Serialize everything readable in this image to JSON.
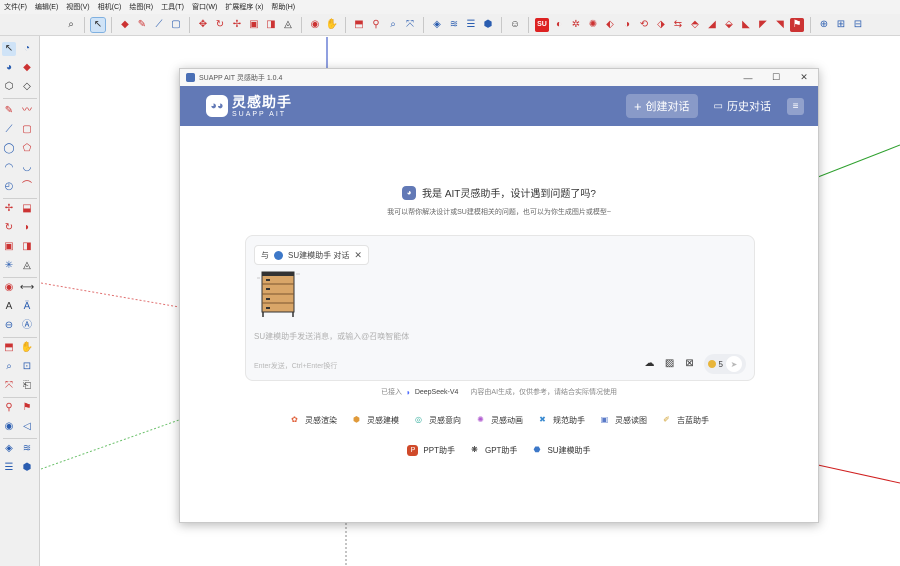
{
  "menu": [
    "文件(F)",
    "编辑(E)",
    "视图(V)",
    "相机(C)",
    "绘图(R)",
    "工具(T)",
    "窗口(W)",
    "扩展程序 (x)",
    "帮助(H)"
  ],
  "window": {
    "title": "SUAPP AIT 灵感助手 1.0.4",
    "minimize": "—",
    "maximize": "☐",
    "close": "✕"
  },
  "header": {
    "logo_cn": "灵感助手",
    "logo_en": "SUAPP AIT",
    "new_chat": "创建对话",
    "history": "历史对话"
  },
  "greeting": {
    "title": "我是 AIT灵感助手，设计遇到问题了吗?",
    "subtitle": "我可以帮你解决设计或SU建模相关的问题，也可以为你生成图片或模型~"
  },
  "input": {
    "context_prefix": "与",
    "context_label": "SU建模助手 对话",
    "placeholder": "SU建模助手发送消息，或输入@召唤智能体",
    "hint": "Enter发送，Ctrl+Enter换行",
    "credits": "5"
  },
  "disclaimer": {
    "prefix": "已接入",
    "model": "DeepSeek-V4",
    "text": "内容由AI生成，仅供参考，请结合实际情况使用"
  },
  "features_row1": [
    {
      "label": "灵感渲染",
      "icon": "render-icon",
      "color": "#e0603a"
    },
    {
      "label": "灵感建模",
      "icon": "cube-icon",
      "color": "#e09a3a"
    },
    {
      "label": "灵感意向",
      "icon": "intent-icon",
      "color": "#3ab0a0"
    },
    {
      "label": "灵感动画",
      "icon": "animation-icon",
      "color": "#b05ad0"
    },
    {
      "label": "规范助手",
      "icon": "rules-icon",
      "color": "#3a8ad0"
    },
    {
      "label": "灵感读图",
      "icon": "image-read-icon",
      "color": "#5a7ac8"
    },
    {
      "label": "吉蓝助手",
      "icon": "brush-icon",
      "color": "#d0a030"
    }
  ],
  "features_row2": [
    {
      "label": "PPT助手",
      "icon": "ppt-icon",
      "color": "#d04a2a"
    },
    {
      "label": "GPT助手",
      "icon": "gpt-icon",
      "color": "#222222"
    },
    {
      "label": "SU建模助手",
      "icon": "su-icon",
      "color": "#3d78c8"
    }
  ]
}
